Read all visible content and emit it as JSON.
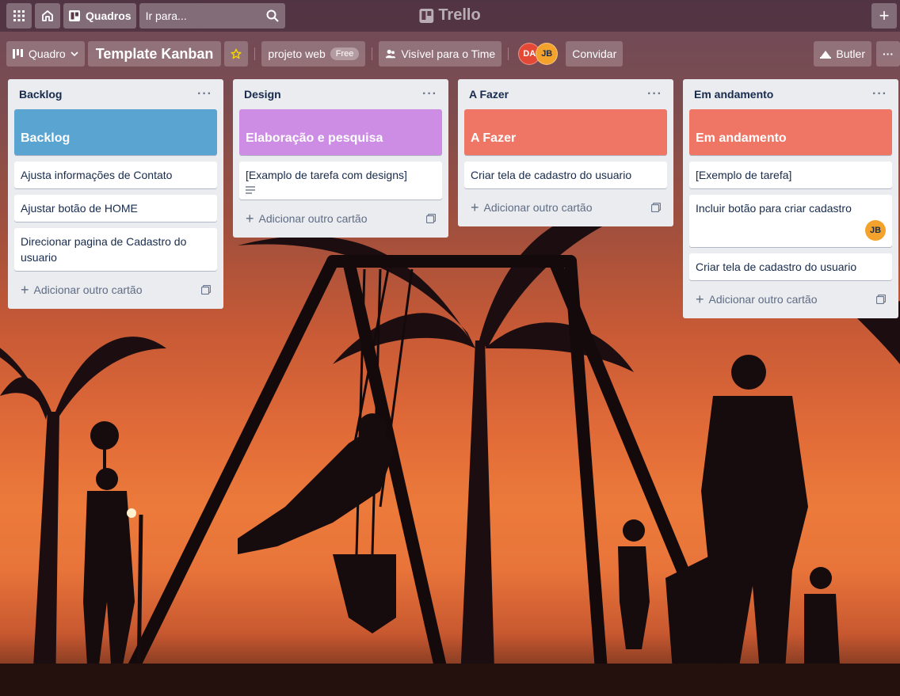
{
  "header": {
    "apps_icon": "grid-icon",
    "home_icon": "home-icon",
    "boards_label": "Quadros",
    "search_placeholder": "Ir para...",
    "logo_text": "Trello",
    "create_icon": "plus-icon"
  },
  "board": {
    "view_label": "Quadro",
    "title": "Template Kanban",
    "team_name": "projeto web",
    "team_badge": "Free",
    "visibility_label": "Visível para o Time",
    "members": [
      "DA",
      "JB"
    ],
    "invite_label": "Convidar",
    "butler_label": "Butler",
    "more_label": "···"
  },
  "lists": [
    {
      "title": "Backlog",
      "menu": "···",
      "cover": {
        "text": "Backlog",
        "color": "#5aa4d1"
      },
      "cards": [
        {
          "text": "Ajusta informações de Contato"
        },
        {
          "text": "Ajustar botão de HOME"
        },
        {
          "text": "Direcionar pagina de Cadastro do usuario"
        }
      ],
      "add_label": "Adicionar outro cartão"
    },
    {
      "title": "Design",
      "menu": "···",
      "cover": {
        "text": "Elaboração e pesquisa",
        "color": "#cd8de5"
      },
      "cards": [
        {
          "text": "[Examplo de tarefa com designs]",
          "has_description": true
        }
      ],
      "add_label": "Adicionar outro cartão"
    },
    {
      "title": "A Fazer",
      "menu": "···",
      "cover": {
        "text": "A Fazer",
        "color": "#ef7564"
      },
      "cards": [
        {
          "text": "Criar tela de cadastro do usuario"
        }
      ],
      "add_label": "Adicionar outro cartão"
    },
    {
      "title": "Em andamento",
      "menu": "···",
      "cover": {
        "text": "Em andamento",
        "color": "#ef7564"
      },
      "cards": [
        {
          "text": "[Exemplo de tarefa]"
        },
        {
          "text": "Incluir botão para criar cadastro",
          "member": "JB"
        },
        {
          "text": "Criar tela de cadastro do usuario"
        }
      ],
      "add_label": "Adicionar outro cartão"
    }
  ]
}
